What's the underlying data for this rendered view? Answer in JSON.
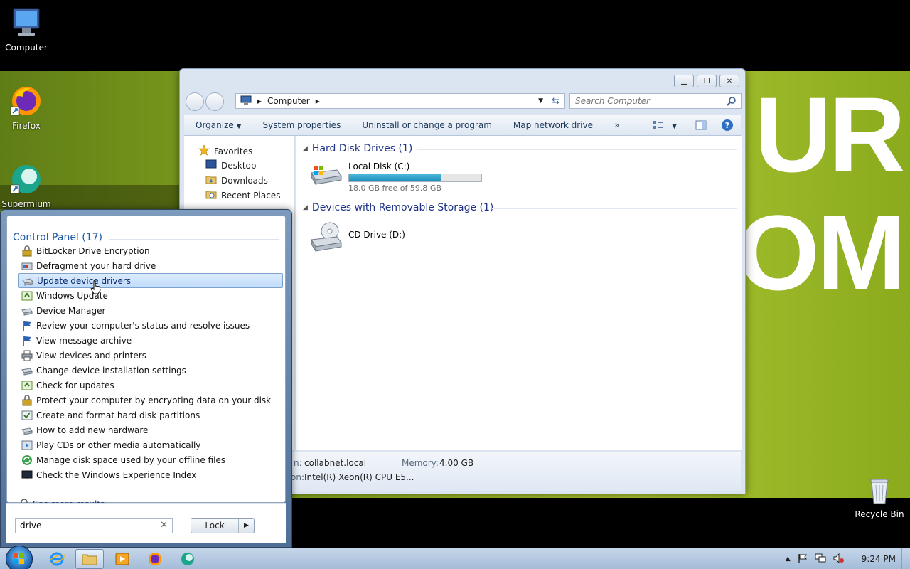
{
  "desktop": {
    "icons": [
      {
        "label": "Computer"
      },
      {
        "label": "Firefox"
      },
      {
        "label": "Supermium"
      },
      {
        "label": "Recycle Bin"
      }
    ],
    "wallpaper_text": [
      "UR",
      "OM"
    ]
  },
  "explorer": {
    "address": {
      "crumb": "Computer"
    },
    "search_placeholder": "Search Computer",
    "toolbar": {
      "organize": "Organize",
      "system_properties": "System properties",
      "uninstall": "Uninstall or change a program",
      "map_drive": "Map network drive",
      "more": "»"
    },
    "nav": {
      "favorites": "Favorites",
      "items": [
        "Desktop",
        "Downloads",
        "Recent Places"
      ]
    },
    "groups": {
      "hdd_title": "Hard Disk Drives (1)",
      "removable_title": "Devices with Removable Storage (1)"
    },
    "drives": {
      "c": {
        "name": "Local Disk (C:)",
        "free_text": "18.0 GB free of 59.8 GB",
        "used_fraction": 0.7
      },
      "d": {
        "name": "CD Drive (D:)"
      }
    },
    "details": {
      "domain_label": "n:",
      "domain_value": "collabnet.local",
      "memory_label": "Memory:",
      "memory_value": "4.00 GB",
      "processor_label": "on:",
      "processor_value": "Intel(R) Xeon(R) CPU E5..."
    }
  },
  "start_menu": {
    "section_title": "Control Panel (17)",
    "items": [
      {
        "label": "BitLocker Drive Encryption",
        "icon": "bitlocker-icon"
      },
      {
        "label": "Defragment your hard drive",
        "icon": "defrag-icon"
      },
      {
        "label": "Update device drivers",
        "icon": "device-icon"
      },
      {
        "label": "Windows Update",
        "icon": "windows-update-icon"
      },
      {
        "label": "Device Manager",
        "icon": "device-icon"
      },
      {
        "label": "Review your computer's status and resolve issues",
        "icon": "flag-icon"
      },
      {
        "label": "View message archive",
        "icon": "flag-icon"
      },
      {
        "label": "View devices and printers",
        "icon": "printer-icon"
      },
      {
        "label": "Change device installation settings",
        "icon": "device-icon"
      },
      {
        "label": "Check for updates",
        "icon": "windows-update-icon"
      },
      {
        "label": "Protect your computer by encrypting data on your disk",
        "icon": "bitlocker-icon"
      },
      {
        "label": "Create and format hard disk partitions",
        "icon": "disk-mgmt-icon"
      },
      {
        "label": "How to add new hardware",
        "icon": "device-icon"
      },
      {
        "label": "Play CDs or other media automatically",
        "icon": "autoplay-icon"
      },
      {
        "label": "Manage disk space used by your offline files",
        "icon": "sync-icon"
      },
      {
        "label": "Check the Windows Experience Index",
        "icon": "monitor-icon"
      }
    ],
    "see_more": "See more results",
    "search_value": "drive",
    "lock_label": "Lock"
  },
  "taskbar": {
    "clock": "9:24 PM"
  },
  "colors": {
    "accent": "#1e5aa6",
    "highlight": "#c1dcfc",
    "drive_bar": "#1d8fbc"
  }
}
